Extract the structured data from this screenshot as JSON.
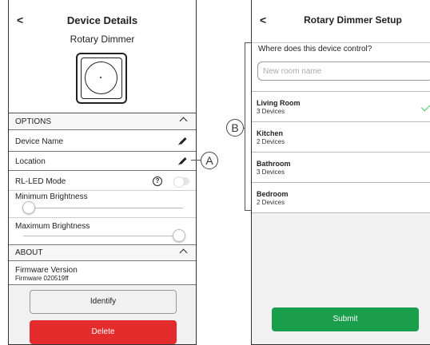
{
  "colors": {
    "delete": "#e42c2c",
    "submit": "#1b9e4b",
    "check": "#3dcd58"
  },
  "icons": {
    "back": "chevron-left-icon",
    "device": "rotary-dimmer-icon",
    "edit": "pencil-icon",
    "help": "question-icon",
    "collapse": "chevron-up-icon",
    "selected": "check-icon"
  },
  "left_screen": {
    "back": "<",
    "title": "Device Details",
    "subtitle": "Rotary Dimmer",
    "options_header": "OPTIONS",
    "device_name_label": "Device Name",
    "location_label": "Location",
    "rl_led_label": "RL-LED Mode",
    "rl_led_enabled": false,
    "help_glyph": "?",
    "min_brightness_label": "Minimum Brightness",
    "min_brightness_fraction": 0.05,
    "max_brightness_label": "Maximum Brightness",
    "max_brightness_fraction": 0.95,
    "about_header": "ABOUT",
    "firmware_label": "Firmware Version",
    "firmware_value": "Firmware 020519ff",
    "identify_label": "Identify",
    "delete_label": "Delete"
  },
  "callouts": {
    "a": "A",
    "b": "B"
  },
  "right_screen": {
    "back": "<",
    "title": "Rotary Dimmer Setup",
    "question": "Where does this device control?",
    "input_placeholder": "New room name",
    "input_value": "",
    "rooms": [
      {
        "name": "Living Room",
        "count": "3 Devices",
        "selected": true
      },
      {
        "name": "Kitchen",
        "count": "2 Devices",
        "selected": false
      },
      {
        "name": "Bathroom",
        "count": "3 Devices",
        "selected": false
      },
      {
        "name": "Bedroom",
        "count": "2 Devices",
        "selected": false
      }
    ],
    "submit_label": "Submit"
  }
}
